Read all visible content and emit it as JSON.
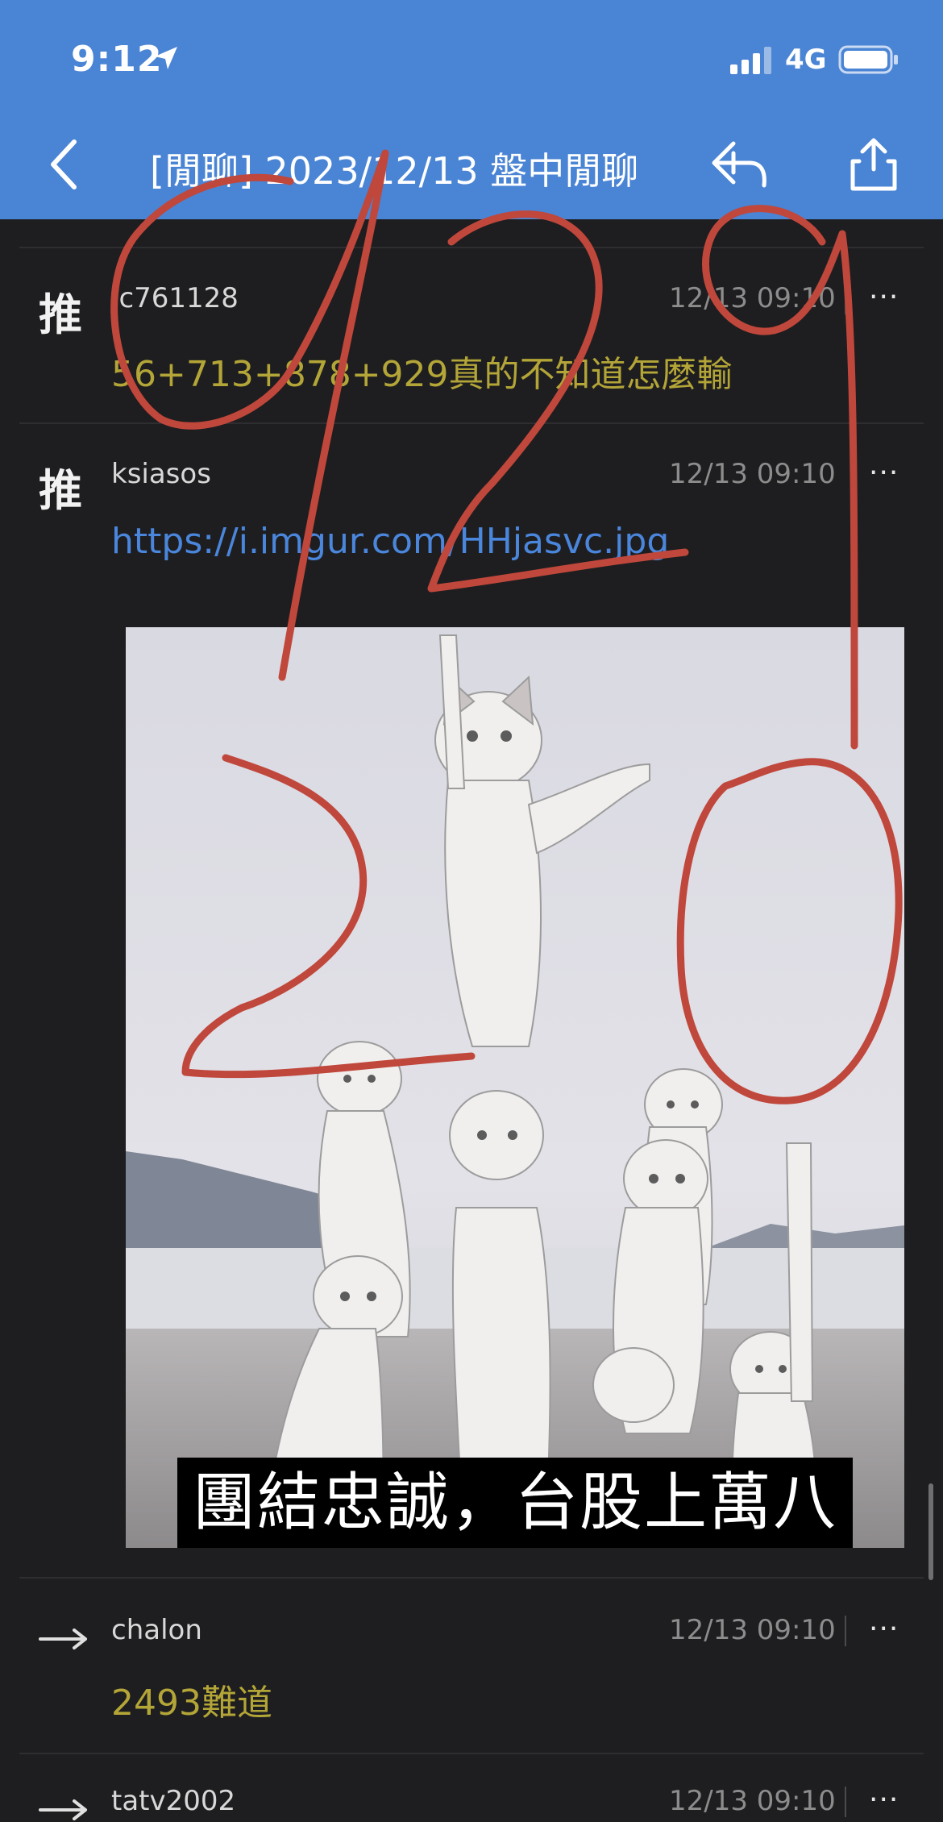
{
  "status_bar": {
    "time": "9:12",
    "network": "4G",
    "icons": [
      "location-arrow-icon",
      "signal-bars-icon",
      "battery-icon"
    ]
  },
  "nav": {
    "title": "[閒聊] 2023/12/13 盤中閒聊",
    "icons": [
      "chevron-left-icon",
      "reply-icon",
      "share-icon"
    ]
  },
  "comments": [
    {
      "kind": "推",
      "author": "jc761128",
      "time": "12/13 09:10",
      "more": "···",
      "content": "56+713+878+929真的不知道怎麼輸"
    },
    {
      "kind": "推",
      "author": "ksiasos",
      "time": "12/13 09:10",
      "more": "···",
      "link": "https://i.imgur.com/HHjasvc.jpg",
      "image_caption": "團結忠誠，台股上萬八"
    },
    {
      "kind": "→",
      "author": "chalon",
      "time": "12/13 09:10",
      "more": "···",
      "content": "2493難道"
    },
    {
      "kind": "→",
      "author": "tatv2002",
      "time": "12/13 09:10",
      "more": "···"
    }
  ],
  "handwriting": "1291 20",
  "colors": {
    "header": "#4a84d4",
    "background": "#1e1e20",
    "comment_text": "#b3a537",
    "link": "#4a86dc",
    "annotation_ink": "#c0473b"
  }
}
